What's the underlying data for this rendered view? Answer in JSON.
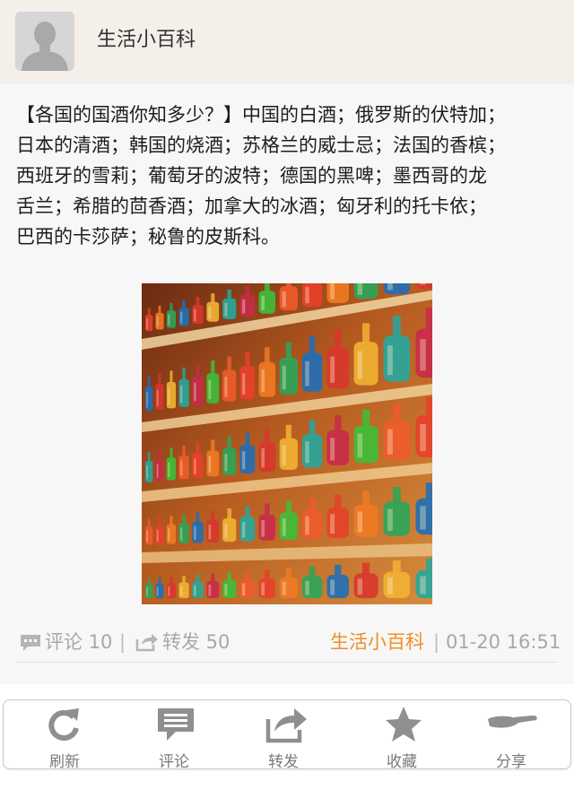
{
  "header": {
    "title": "生活小百科"
  },
  "post": {
    "text": "【各国的国酒你知多少？】中国的白酒；俄罗斯的伏特加；\n日本的清酒；韩国的烧酒；苏格兰的威士忌；法国的香槟；\n西班牙的雪莉；葡萄牙的波特；德国的黑啤；墨西哥的龙\n舌兰；希腊的茴香酒；加拿大的冰酒；匈牙利的托卡依；\n巴西的卡莎萨；秘鲁的皮斯科。",
    "comment_label": "评论 10",
    "repost_label": "转发 50",
    "separator": "|",
    "source": "生活小百科",
    "time": "01-20 16:51"
  },
  "toolbar": {
    "items": [
      {
        "label": "刷新",
        "icon": "refresh-icon"
      },
      {
        "label": "评论",
        "icon": "comment-icon"
      },
      {
        "label": "转发",
        "icon": "repost-icon"
      },
      {
        "label": "收藏",
        "icon": "star-icon"
      },
      {
        "label": "分享",
        "icon": "share-icon"
      }
    ]
  },
  "colors": {
    "header_bg": "#f4efe9",
    "source_accent": "#f08e28",
    "meta_gray": "#a8a8a8",
    "icon_gray": "#8f8f8f"
  }
}
